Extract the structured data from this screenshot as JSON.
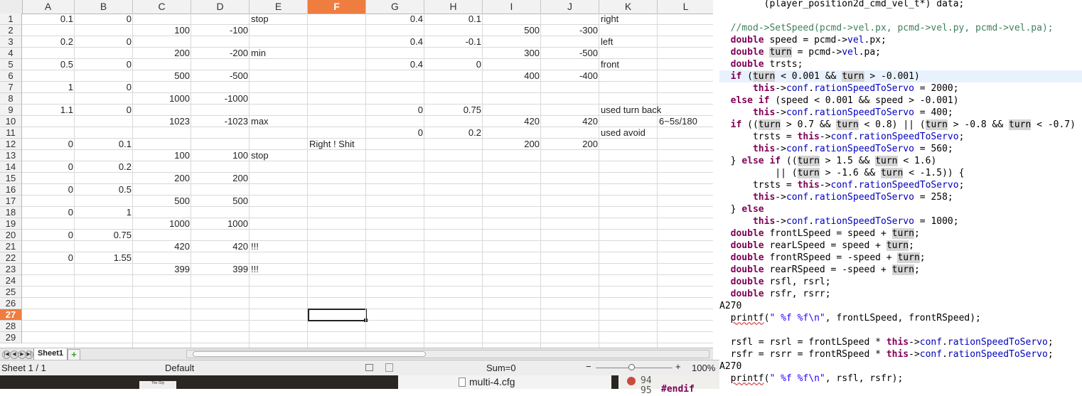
{
  "spreadsheet": {
    "columns": [
      "A",
      "B",
      "C",
      "D",
      "E",
      "F",
      "G",
      "H",
      "I",
      "J",
      "K",
      "L"
    ],
    "selected_column": "F",
    "rows": [
      "1",
      "2",
      "3",
      "4",
      "5",
      "6",
      "7",
      "8",
      "9",
      "10",
      "11",
      "12",
      "13",
      "14",
      "15",
      "16",
      "17",
      "18",
      "19",
      "20",
      "21",
      "22",
      "23",
      "24",
      "25",
      "26",
      "27",
      "28",
      "29"
    ],
    "selected_row": "27",
    "cells": [
      {
        "r": 1,
        "c": "A",
        "v": "0.1",
        "t": "num"
      },
      {
        "r": 1,
        "c": "B",
        "v": "0",
        "t": "num"
      },
      {
        "r": 1,
        "c": "E",
        "v": "stop",
        "t": "txt"
      },
      {
        "r": 1,
        "c": "G",
        "v": "0.4",
        "t": "num"
      },
      {
        "r": 1,
        "c": "H",
        "v": "0.1",
        "t": "num"
      },
      {
        "r": 1,
        "c": "K",
        "v": "right",
        "t": "txt"
      },
      {
        "r": 2,
        "c": "C",
        "v": "100",
        "t": "num"
      },
      {
        "r": 2,
        "c": "D",
        "v": "-100",
        "t": "num"
      },
      {
        "r": 2,
        "c": "I",
        "v": "500",
        "t": "num"
      },
      {
        "r": 2,
        "c": "J",
        "v": "-300",
        "t": "num"
      },
      {
        "r": 3,
        "c": "A",
        "v": "0.2",
        "t": "num"
      },
      {
        "r": 3,
        "c": "B",
        "v": "0",
        "t": "num"
      },
      {
        "r": 3,
        "c": "G",
        "v": "0.4",
        "t": "num"
      },
      {
        "r": 3,
        "c": "H",
        "v": "-0.1",
        "t": "num"
      },
      {
        "r": 3,
        "c": "K",
        "v": "left",
        "t": "txt"
      },
      {
        "r": 4,
        "c": "C",
        "v": "200",
        "t": "num"
      },
      {
        "r": 4,
        "c": "D",
        "v": "-200",
        "t": "num"
      },
      {
        "r": 4,
        "c": "E",
        "v": "min",
        "t": "txt"
      },
      {
        "r": 4,
        "c": "I",
        "v": "300",
        "t": "num"
      },
      {
        "r": 4,
        "c": "J",
        "v": "-500",
        "t": "num"
      },
      {
        "r": 5,
        "c": "A",
        "v": "0.5",
        "t": "num"
      },
      {
        "r": 5,
        "c": "B",
        "v": "0",
        "t": "num"
      },
      {
        "r": 5,
        "c": "G",
        "v": "0.4",
        "t": "num"
      },
      {
        "r": 5,
        "c": "H",
        "v": "0",
        "t": "num"
      },
      {
        "r": 5,
        "c": "K",
        "v": "front",
        "t": "txt"
      },
      {
        "r": 6,
        "c": "C",
        "v": "500",
        "t": "num"
      },
      {
        "r": 6,
        "c": "D",
        "v": "-500",
        "t": "num"
      },
      {
        "r": 6,
        "c": "I",
        "v": "400",
        "t": "num"
      },
      {
        "r": 6,
        "c": "J",
        "v": "-400",
        "t": "num"
      },
      {
        "r": 7,
        "c": "A",
        "v": "1",
        "t": "num"
      },
      {
        "r": 7,
        "c": "B",
        "v": "0",
        "t": "num"
      },
      {
        "r": 8,
        "c": "C",
        "v": "1000",
        "t": "num"
      },
      {
        "r": 8,
        "c": "D",
        "v": "-1000",
        "t": "num"
      },
      {
        "r": 9,
        "c": "A",
        "v": "1.1",
        "t": "num"
      },
      {
        "r": 9,
        "c": "B",
        "v": "0",
        "t": "num"
      },
      {
        "r": 9,
        "c": "G",
        "v": "0",
        "t": "num"
      },
      {
        "r": 9,
        "c": "H",
        "v": "0.75",
        "t": "num"
      },
      {
        "r": 9,
        "c": "K",
        "v": "used turn back",
        "t": "txt"
      },
      {
        "r": 10,
        "c": "C",
        "v": "1023",
        "t": "num"
      },
      {
        "r": 10,
        "c": "D",
        "v": "-1023",
        "t": "num"
      },
      {
        "r": 10,
        "c": "E",
        "v": "max",
        "t": "txt"
      },
      {
        "r": 10,
        "c": "I",
        "v": "420",
        "t": "num"
      },
      {
        "r": 10,
        "c": "J",
        "v": "420",
        "t": "num"
      },
      {
        "r": 10,
        "c": "L",
        "v": "6~5s/180",
        "t": "txt"
      },
      {
        "r": 11,
        "c": "G",
        "v": "0",
        "t": "num"
      },
      {
        "r": 11,
        "c": "H",
        "v": "0.2",
        "t": "num"
      },
      {
        "r": 11,
        "c": "K",
        "v": "used avoid",
        "t": "txt"
      },
      {
        "r": 12,
        "c": "A",
        "v": "0",
        "t": "num"
      },
      {
        "r": 12,
        "c": "B",
        "v": "0.1",
        "t": "num"
      },
      {
        "r": 12,
        "c": "F",
        "v": "Right ! Shit",
        "t": "txt"
      },
      {
        "r": 12,
        "c": "I",
        "v": "200",
        "t": "num"
      },
      {
        "r": 12,
        "c": "J",
        "v": "200",
        "t": "num"
      },
      {
        "r": 13,
        "c": "C",
        "v": "100",
        "t": "num"
      },
      {
        "r": 13,
        "c": "D",
        "v": "100",
        "t": "num"
      },
      {
        "r": 13,
        "c": "E",
        "v": "stop",
        "t": "txt"
      },
      {
        "r": 14,
        "c": "A",
        "v": "0",
        "t": "num"
      },
      {
        "r": 14,
        "c": "B",
        "v": "0.2",
        "t": "num"
      },
      {
        "r": 15,
        "c": "C",
        "v": "200",
        "t": "num"
      },
      {
        "r": 15,
        "c": "D",
        "v": "200",
        "t": "num"
      },
      {
        "r": 16,
        "c": "A",
        "v": "0",
        "t": "num"
      },
      {
        "r": 16,
        "c": "B",
        "v": "0.5",
        "t": "num"
      },
      {
        "r": 17,
        "c": "C",
        "v": "500",
        "t": "num"
      },
      {
        "r": 17,
        "c": "D",
        "v": "500",
        "t": "num"
      },
      {
        "r": 18,
        "c": "A",
        "v": "0",
        "t": "num"
      },
      {
        "r": 18,
        "c": "B",
        "v": "1",
        "t": "num"
      },
      {
        "r": 19,
        "c": "C",
        "v": "1000",
        "t": "num"
      },
      {
        "r": 19,
        "c": "D",
        "v": "1000",
        "t": "num"
      },
      {
        "r": 20,
        "c": "A",
        "v": "0",
        "t": "num"
      },
      {
        "r": 20,
        "c": "B",
        "v": "0.75",
        "t": "num"
      },
      {
        "r": 21,
        "c": "C",
        "v": "420",
        "t": "num"
      },
      {
        "r": 21,
        "c": "D",
        "v": "420",
        "t": "num"
      },
      {
        "r": 21,
        "c": "E",
        "v": "!!!",
        "t": "txt"
      },
      {
        "r": 22,
        "c": "A",
        "v": "0",
        "t": "num"
      },
      {
        "r": 22,
        "c": "B",
        "v": "1.55",
        "t": "num"
      },
      {
        "r": 23,
        "c": "C",
        "v": "399",
        "t": "num"
      },
      {
        "r": 23,
        "c": "D",
        "v": "399",
        "t": "num"
      },
      {
        "r": 23,
        "c": "E",
        "v": "!!!",
        "t": "txt"
      }
    ],
    "active_cell": "F27",
    "sheet_tab": "Sheet1",
    "status": {
      "sheet": "Sheet 1 / 1",
      "style": "Default",
      "sum": "Sum=0",
      "zoom": "100%"
    },
    "colors": {
      "selected_header": "#ef7d3f"
    }
  },
  "desktop": {
    "file_label": "multi-4.cfg",
    "line_numbers": [
      "94",
      "95"
    ],
    "endif_text": "#endif",
    "thumb_text": "The City"
  },
  "editor": {
    "lines": [
      {
        "segs": [
          [
            "        (player_position2d_cmd_vel_t*) data;",
            ""
          ]
        ]
      },
      {
        "segs": [
          [
            "",
            ""
          ]
        ]
      },
      {
        "segs": [
          [
            "  //mod->SetSpeed(pcmd->vel.px, pcmd->vel.py, pcmd->vel.pa);",
            "cmt"
          ]
        ]
      },
      {
        "segs": [
          [
            "  ",
            ""
          ],
          [
            "double",
            "kw"
          ],
          [
            " speed = pcmd->",
            ""
          ],
          [
            "vel",
            "fld"
          ],
          [
            ".px;",
            ""
          ]
        ]
      },
      {
        "segs": [
          [
            "  ",
            ""
          ],
          [
            "double",
            "kw"
          ],
          [
            " ",
            ""
          ],
          [
            "turn",
            "occ"
          ],
          [
            " = pcmd->",
            ""
          ],
          [
            "vel",
            "fld"
          ],
          [
            ".pa;",
            ""
          ]
        ]
      },
      {
        "segs": [
          [
            "  ",
            ""
          ],
          [
            "double",
            "kw"
          ],
          [
            " trsts;",
            ""
          ]
        ]
      },
      {
        "hl": true,
        "segs": [
          [
            "  ",
            ""
          ],
          [
            "if",
            "kw"
          ],
          [
            " (",
            ""
          ],
          [
            "turn",
            "occ"
          ],
          [
            " < 0.001 && ",
            ""
          ],
          [
            "turn",
            "occ"
          ],
          [
            " > -0.001)",
            ""
          ]
        ]
      },
      {
        "segs": [
          [
            "      ",
            ""
          ],
          [
            "this",
            "kw"
          ],
          [
            "->",
            ""
          ],
          [
            "conf",
            "fld"
          ],
          [
            ".",
            ""
          ],
          [
            "rationSpeedToServo",
            "fld"
          ],
          [
            " = 2000;",
            ""
          ]
        ]
      },
      {
        "segs": [
          [
            "  ",
            ""
          ],
          [
            "else if",
            "kw"
          ],
          [
            " (speed < 0.001 && speed > -0.001)",
            ""
          ]
        ]
      },
      {
        "segs": [
          [
            "      ",
            ""
          ],
          [
            "this",
            "kw"
          ],
          [
            "->",
            ""
          ],
          [
            "conf",
            "fld"
          ],
          [
            ".",
            ""
          ],
          [
            "rationSpeedToServo",
            "fld"
          ],
          [
            " = 400;",
            ""
          ]
        ]
      },
      {
        "segs": [
          [
            "  ",
            ""
          ],
          [
            "if",
            "kw"
          ],
          [
            " ((",
            ""
          ],
          [
            "turn",
            "occ"
          ],
          [
            " > 0.7 && ",
            ""
          ],
          [
            "turn",
            "occ"
          ],
          [
            " < 0.8) || (",
            ""
          ],
          [
            "turn",
            "occ"
          ],
          [
            " > -0.8 && ",
            ""
          ],
          [
            "turn",
            "occ"
          ],
          [
            " < -0.7)",
            ""
          ]
        ]
      },
      {
        "segs": [
          [
            "      trsts = ",
            ""
          ],
          [
            "this",
            "kw"
          ],
          [
            "->",
            ""
          ],
          [
            "conf",
            "fld"
          ],
          [
            ".",
            ""
          ],
          [
            "rationSpeedToServo",
            "fld"
          ],
          [
            ";",
            ""
          ]
        ]
      },
      {
        "segs": [
          [
            "      ",
            ""
          ],
          [
            "this",
            "kw"
          ],
          [
            "->",
            ""
          ],
          [
            "conf",
            "fld"
          ],
          [
            ".",
            ""
          ],
          [
            "rationSpeedToServo",
            "fld"
          ],
          [
            " = 560;",
            ""
          ]
        ]
      },
      {
        "segs": [
          [
            "  } ",
            ""
          ],
          [
            "else if",
            "kw"
          ],
          [
            " ((",
            ""
          ],
          [
            "turn",
            "occ"
          ],
          [
            " > 1.5 && ",
            ""
          ],
          [
            "turn",
            "occ"
          ],
          [
            " < 1.6)",
            ""
          ]
        ]
      },
      {
        "segs": [
          [
            "          || (",
            ""
          ],
          [
            "turn",
            "occ"
          ],
          [
            " > -1.6 && ",
            ""
          ],
          [
            "turn",
            "occ"
          ],
          [
            " < -1.5)) {",
            ""
          ]
        ]
      },
      {
        "segs": [
          [
            "      trsts = ",
            ""
          ],
          [
            "this",
            "kw"
          ],
          [
            "->",
            ""
          ],
          [
            "conf",
            "fld"
          ],
          [
            ".",
            ""
          ],
          [
            "rationSpeedToServo",
            "fld"
          ],
          [
            ";",
            ""
          ]
        ]
      },
      {
        "segs": [
          [
            "      ",
            ""
          ],
          [
            "this",
            "kw"
          ],
          [
            "->",
            ""
          ],
          [
            "conf",
            "fld"
          ],
          [
            ".",
            ""
          ],
          [
            "rationSpeedToServo",
            "fld"
          ],
          [
            " = 258;",
            ""
          ]
        ]
      },
      {
        "segs": [
          [
            "  } ",
            ""
          ],
          [
            "else",
            "kw"
          ]
        ]
      },
      {
        "segs": [
          [
            "      ",
            ""
          ],
          [
            "this",
            "kw"
          ],
          [
            "->",
            ""
          ],
          [
            "conf",
            "fld"
          ],
          [
            ".",
            ""
          ],
          [
            "rationSpeedToServo",
            "fld"
          ],
          [
            " = 1000;",
            ""
          ]
        ]
      },
      {
        "segs": [
          [
            "  ",
            ""
          ],
          [
            "double",
            "kw"
          ],
          [
            " frontLSpeed = speed + ",
            ""
          ],
          [
            "turn",
            "occ"
          ],
          [
            ";",
            ""
          ]
        ]
      },
      {
        "segs": [
          [
            "  ",
            ""
          ],
          [
            "double",
            "kw"
          ],
          [
            " rearLSpeed = speed + ",
            ""
          ],
          [
            "turn",
            "occ"
          ],
          [
            ";",
            ""
          ]
        ]
      },
      {
        "segs": [
          [
            "  ",
            ""
          ],
          [
            "double",
            "kw"
          ],
          [
            " frontRSpeed = -speed + ",
            ""
          ],
          [
            "turn",
            "occ"
          ],
          [
            ";",
            ""
          ]
        ]
      },
      {
        "segs": [
          [
            "  ",
            ""
          ],
          [
            "double",
            "kw"
          ],
          [
            " rearRSpeed = -speed + ",
            ""
          ],
          [
            "turn",
            "occ"
          ],
          [
            ";",
            ""
          ]
        ]
      },
      {
        "segs": [
          [
            "  ",
            ""
          ],
          [
            "double",
            "kw"
          ],
          [
            " rsfl, rsrl;",
            ""
          ]
        ]
      },
      {
        "segs": [
          [
            "  ",
            ""
          ],
          [
            "double",
            "kw"
          ],
          [
            " rsfr, rsrr;",
            ""
          ]
        ]
      },
      {
        "segs": [
          [
            "A270",
            ""
          ]
        ]
      },
      {
        "segs": [
          [
            "  ",
            ""
          ],
          [
            "printf",
            "ann"
          ],
          [
            "(",
            ""
          ],
          [
            "\" %f %f\\n\"",
            "str"
          ],
          [
            ", frontLSpeed, frontRSpeed);",
            ""
          ]
        ]
      },
      {
        "segs": [
          [
            "",
            ""
          ]
        ]
      },
      {
        "segs": [
          [
            "  rsfl = rsrl = frontLSpeed * ",
            ""
          ],
          [
            "this",
            "kw"
          ],
          [
            "->",
            ""
          ],
          [
            "conf",
            "fld"
          ],
          [
            ".",
            ""
          ],
          [
            "rationSpeedToServo",
            "fld"
          ],
          [
            ";",
            ""
          ]
        ]
      },
      {
        "segs": [
          [
            "  rsfr = rsrr = frontRSpeed * ",
            ""
          ],
          [
            "this",
            "kw"
          ],
          [
            "->",
            ""
          ],
          [
            "conf",
            "fld"
          ],
          [
            ".",
            ""
          ],
          [
            "rationSpeedToServo",
            "fld"
          ],
          [
            ";",
            ""
          ]
        ]
      },
      {
        "segs": [
          [
            "A270",
            ""
          ]
        ]
      },
      {
        "segs": [
          [
            "  ",
            ""
          ],
          [
            "printf",
            "ann"
          ],
          [
            "(",
            ""
          ],
          [
            "\" %f %f\\n\"",
            "str"
          ],
          [
            ", rsfl, rsfr);",
            ""
          ]
        ]
      }
    ]
  }
}
